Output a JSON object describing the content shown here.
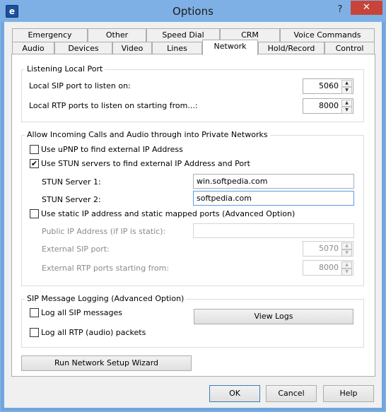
{
  "window": {
    "title": "Options",
    "help_glyph": "?",
    "close_glyph": "✕",
    "icon_letter": "e"
  },
  "tabs_row1": [
    "Emergency",
    "Other",
    "Speed Dial",
    "CRM",
    "Voice Commands"
  ],
  "tabs_row2": [
    "Audio",
    "Devices",
    "Video",
    "Lines",
    "Network",
    "Hold/Record",
    "Control"
  ],
  "active_tab": "Network",
  "listening": {
    "title": "Listening Local Port",
    "sip_label": "Local SIP port to listen on:",
    "sip_value": "5060",
    "rtp_label": "Local RTP ports to listen on starting from...:",
    "rtp_value": "8000"
  },
  "incoming": {
    "title": "Allow Incoming Calls and Audio through into Private Networks",
    "upnp_label": "Use uPNP to find external IP Address",
    "upnp_checked": false,
    "stun_label": "Use STUN servers to find external IP Address and Port",
    "stun_checked": true,
    "stun1_label": "STUN Server 1:",
    "stun1_value": "win.softpedia.com",
    "stun2_label": "STUN Server 2:",
    "stun2_value": "softpedia.com",
    "static_label": "Use static IP address and static mapped ports (Advanced Option)",
    "static_checked": false,
    "public_ip_label": "Public IP Address (if IP is static):",
    "public_ip_value": "",
    "ext_sip_label": "External SIP port:",
    "ext_sip_value": "5070",
    "ext_rtp_label": "External RTP ports starting from:",
    "ext_rtp_value": "8000"
  },
  "logging": {
    "title": "SIP Message Logging (Advanced Option)",
    "sip_label": "Log all SIP messages",
    "sip_checked": false,
    "rtp_label": "Log all RTP (audio) packets",
    "rtp_checked": false,
    "view_logs": "View Logs"
  },
  "wizard_button": "Run Network Setup Wizard",
  "buttons": {
    "ok": "OK",
    "cancel": "Cancel",
    "help": "Help"
  },
  "spin_up": "▲",
  "spin_down": "▼",
  "check_mark": "✔",
  "colors": {
    "title_bar": "#7fb0e5",
    "close": "#c7443a",
    "focus_border": "#569de5"
  }
}
